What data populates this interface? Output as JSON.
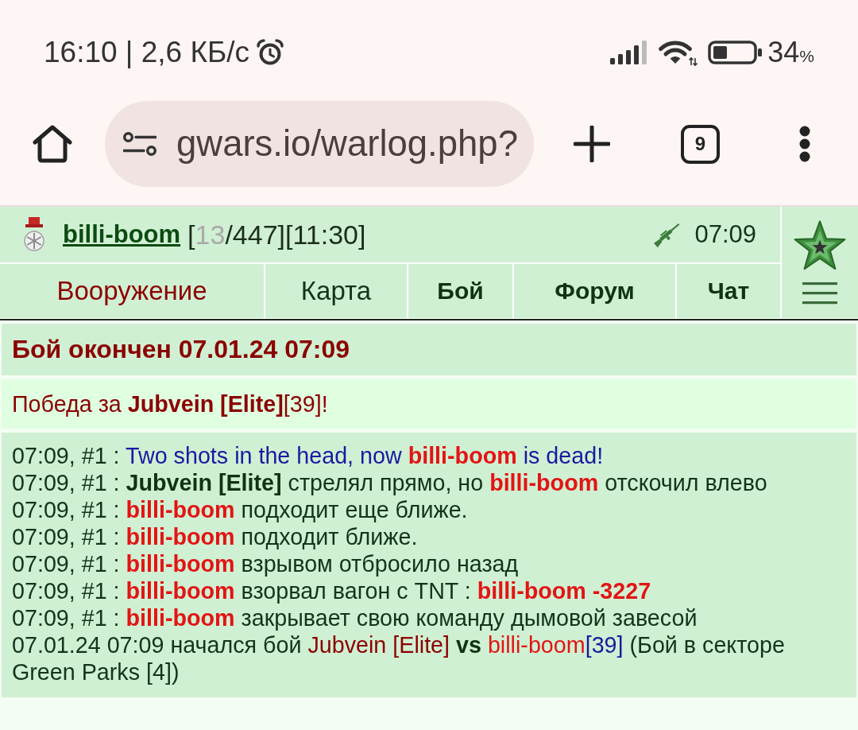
{
  "status_bar": {
    "time_speed": "16:10 | 2,6 КБ/с",
    "battery": "34",
    "battery_unit": "%"
  },
  "browser": {
    "url": "gwars.io/warlog.php?",
    "tab_count": "9"
  },
  "header": {
    "player": "billi-boom",
    "stats": [
      {
        "kind": "plain",
        "text": "["
      },
      {
        "kind": "muted",
        "text": "13"
      },
      {
        "kind": "plain",
        "text": "/447][11:30]"
      }
    ],
    "time": "07:09"
  },
  "nav": [
    {
      "label": "Вооружение",
      "kind": "alert"
    },
    {
      "label": "Карта",
      "kind": "plain"
    },
    {
      "label": "Бой",
      "kind": "bold"
    },
    {
      "label": "Форум",
      "kind": "bold"
    },
    {
      "label": "Чат",
      "kind": "bold"
    }
  ],
  "battle": {
    "title": "Бой окончен 07.01.24 07:09",
    "result": "Победа за **Jubvein [Elite]**[39]!",
    "log": [
      {
        "segments": [
          {
            "kind": "plain",
            "text": "07:09, #1 : "
          },
          {
            "kind": "event",
            "text": "Two shots in the head, now "
          },
          {
            "kind": "player",
            "text": "billi-boom"
          },
          {
            "kind": "event",
            "text": " is dead!"
          }
        ]
      },
      {
        "segments": [
          {
            "kind": "plain",
            "text": "07:09, #1 : "
          },
          {
            "kind": "strong",
            "text": "Jubvein [Elite]"
          },
          {
            "kind": "plain",
            "text": " стрелял прямо, но "
          },
          {
            "kind": "player",
            "text": "billi-boom"
          },
          {
            "kind": "plain",
            "text": " отскочил влево"
          }
        ]
      },
      {
        "segments": [
          {
            "kind": "plain",
            "text": "07:09, #1 : "
          },
          {
            "kind": "player",
            "text": "billi-boom"
          },
          {
            "kind": "plain",
            "text": " подходит еще ближе."
          }
        ]
      },
      {
        "segments": [
          {
            "kind": "plain",
            "text": "07:09, #1 : "
          },
          {
            "kind": "player",
            "text": "billi-boom"
          },
          {
            "kind": "plain",
            "text": " подходит ближе."
          }
        ]
      },
      {
        "segments": [
          {
            "kind": "plain",
            "text": "07:09, #1 : "
          },
          {
            "kind": "player",
            "text": "billi-boom"
          },
          {
            "kind": "plain",
            "text": " взрывом отбросило назад"
          }
        ]
      },
      {
        "segments": [
          {
            "kind": "plain",
            "text": "07:09, #1 : "
          },
          {
            "kind": "player",
            "text": "billi-boom"
          },
          {
            "kind": "plain",
            "text": " взорвал вагон с TNT : "
          },
          {
            "kind": "player",
            "text": "billi-boom -3227"
          }
        ]
      },
      {
        "segments": [
          {
            "kind": "plain",
            "text": "07:09, #1 : "
          },
          {
            "kind": "player",
            "text": "billi-boom"
          },
          {
            "kind": "plain",
            "text": " закрывает свою команду дымовой завесой"
          }
        ]
      },
      {
        "segments": [
          {
            "kind": "plain",
            "text": "07.01.24 07:09 начался бой "
          },
          {
            "kind": "team",
            "text": "Jubvein [Elite]"
          },
          {
            "kind": "strong",
            "text": " vs "
          },
          {
            "kind": "enemy",
            "text": "billi-boom"
          },
          {
            "kind": "level",
            "text": "[39]"
          },
          {
            "kind": "plain",
            "text": " (Бой в секторе Green Parks [4])"
          }
        ]
      }
    ]
  }
}
